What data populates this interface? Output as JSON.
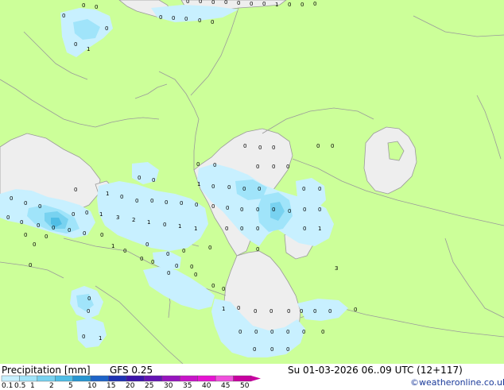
{
  "legend": {
    "title": "Precipitation [mm]",
    "model": "GFS 0.25",
    "datetime": "Su 01-03-2026 06..09 UTC (12+117)",
    "credit": "©weatheronline.co.uk",
    "ticks": [
      "0.1",
      "0.5",
      "1",
      "2",
      "5",
      "10",
      "15",
      "20",
      "25",
      "30",
      "35",
      "40",
      "45",
      "50"
    ],
    "colors": [
      "#c8f0ff",
      "#a0e4fa",
      "#78d2f0",
      "#50bee6",
      "#2896d2",
      "#1e64c8",
      "#1e32b4",
      "#3c14aa",
      "#6414b4",
      "#9614be",
      "#c814c8",
      "#e614d2",
      "#f050dc",
      "#c800a0"
    ]
  },
  "colors": {
    "land": "#ccff99",
    "sea": "#eeeeee",
    "border": "#9a9a9a",
    "precip_light": "#c8f0ff",
    "precip_mid": "#a0e4fa",
    "precip_heavy": "#78d2f0",
    "precip_max": "#50bee6"
  },
  "values": [
    "0",
    "0",
    "0",
    "0",
    "0",
    "0",
    "0",
    "0",
    "0",
    "0",
    "0",
    "0",
    "0",
    "0",
    "0",
    "0",
    "0",
    "1",
    "1",
    "0",
    "0",
    "0",
    "0",
    "0",
    "0",
    "0",
    "0",
    "0",
    "0",
    "0",
    "1",
    "0",
    "0",
    "0",
    "0",
    "0",
    "0",
    "0",
    "0",
    "0",
    "0",
    "0",
    "0",
    "0",
    "0",
    "0",
    "0",
    "0",
    "1",
    "3",
    "2",
    "1",
    "0",
    "1",
    "1",
    "1",
    "0",
    "0",
    "0",
    "0",
    "0",
    "0",
    "0",
    "0",
    "0",
    "0",
    "0",
    "0",
    "0",
    "0",
    "0",
    "0",
    "0",
    "0",
    "1",
    "0",
    "0",
    "0",
    "0",
    "0",
    "0",
    "0",
    "3",
    "0",
    "0",
    "0",
    "1",
    "0",
    "1",
    "0",
    "0",
    "0",
    "0",
    "0",
    "0",
    "0",
    "0",
    "0",
    "0",
    "0",
    "0",
    "0",
    "0",
    "0",
    "0",
    "0",
    "0",
    "0",
    "0",
    "0",
    "0",
    "0",
    "0",
    "0",
    "0",
    "0",
    "0",
    "0",
    "0",
    "1",
    "0",
    "0",
    "0"
  ]
}
